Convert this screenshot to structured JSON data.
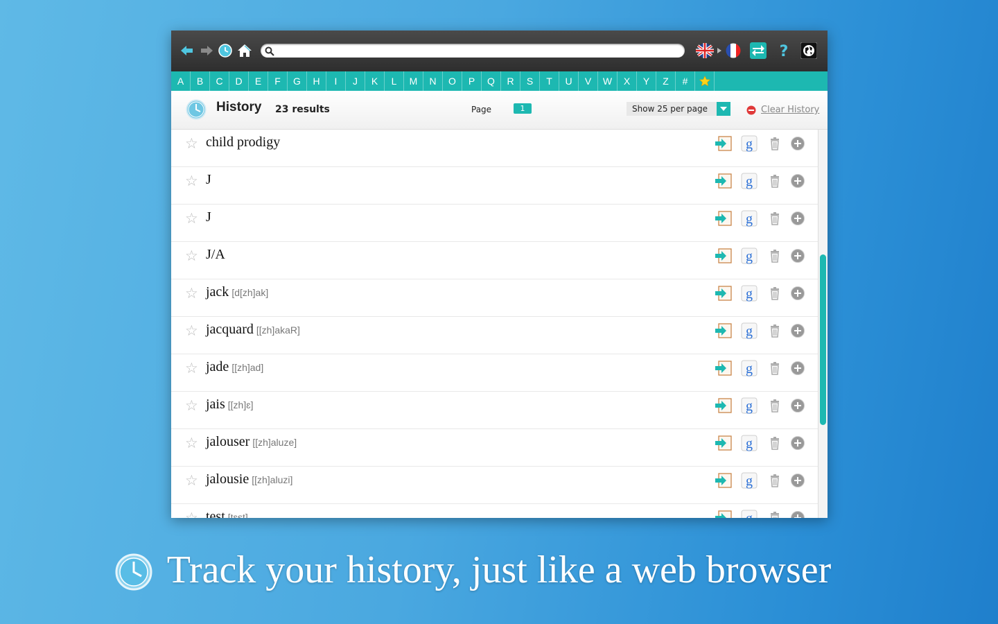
{
  "search": {
    "placeholder": ""
  },
  "alphabet": [
    "A",
    "B",
    "C",
    "D",
    "E",
    "F",
    "G",
    "H",
    "I",
    "J",
    "K",
    "L",
    "M",
    "N",
    "O",
    "P",
    "Q",
    "R",
    "S",
    "T",
    "U",
    "V",
    "W",
    "X",
    "Y",
    "Z",
    "#"
  ],
  "header": {
    "title": "History",
    "count": "23 results",
    "page_label": "Page",
    "page_number": "1",
    "per_page": "Show 25 per page",
    "clear": "Clear History"
  },
  "rows": [
    {
      "word": "child prodigy",
      "pron": ""
    },
    {
      "word": "J",
      "pron": ""
    },
    {
      "word": "J",
      "pron": ""
    },
    {
      "word": "J/A",
      "pron": ""
    },
    {
      "word": "jack",
      "pron": "[d[zh]ak]"
    },
    {
      "word": "jacquard",
      "pron": "[[zh]akaR]"
    },
    {
      "word": "jade",
      "pron": "[[zh]ad]"
    },
    {
      "word": "jais",
      "pron": "[[zh]ɛ]"
    },
    {
      "word": "jalouser",
      "pron": "[[zh]aluze]"
    },
    {
      "word": "jalousie",
      "pron": "[[zh]aluzi]"
    },
    {
      "word": "test",
      "pron": "[tɛst]"
    }
  ],
  "caption": "Track your history, just like a web browser",
  "colors": {
    "accent": "#1db8b1",
    "toolbar": "#3a3a3a"
  }
}
